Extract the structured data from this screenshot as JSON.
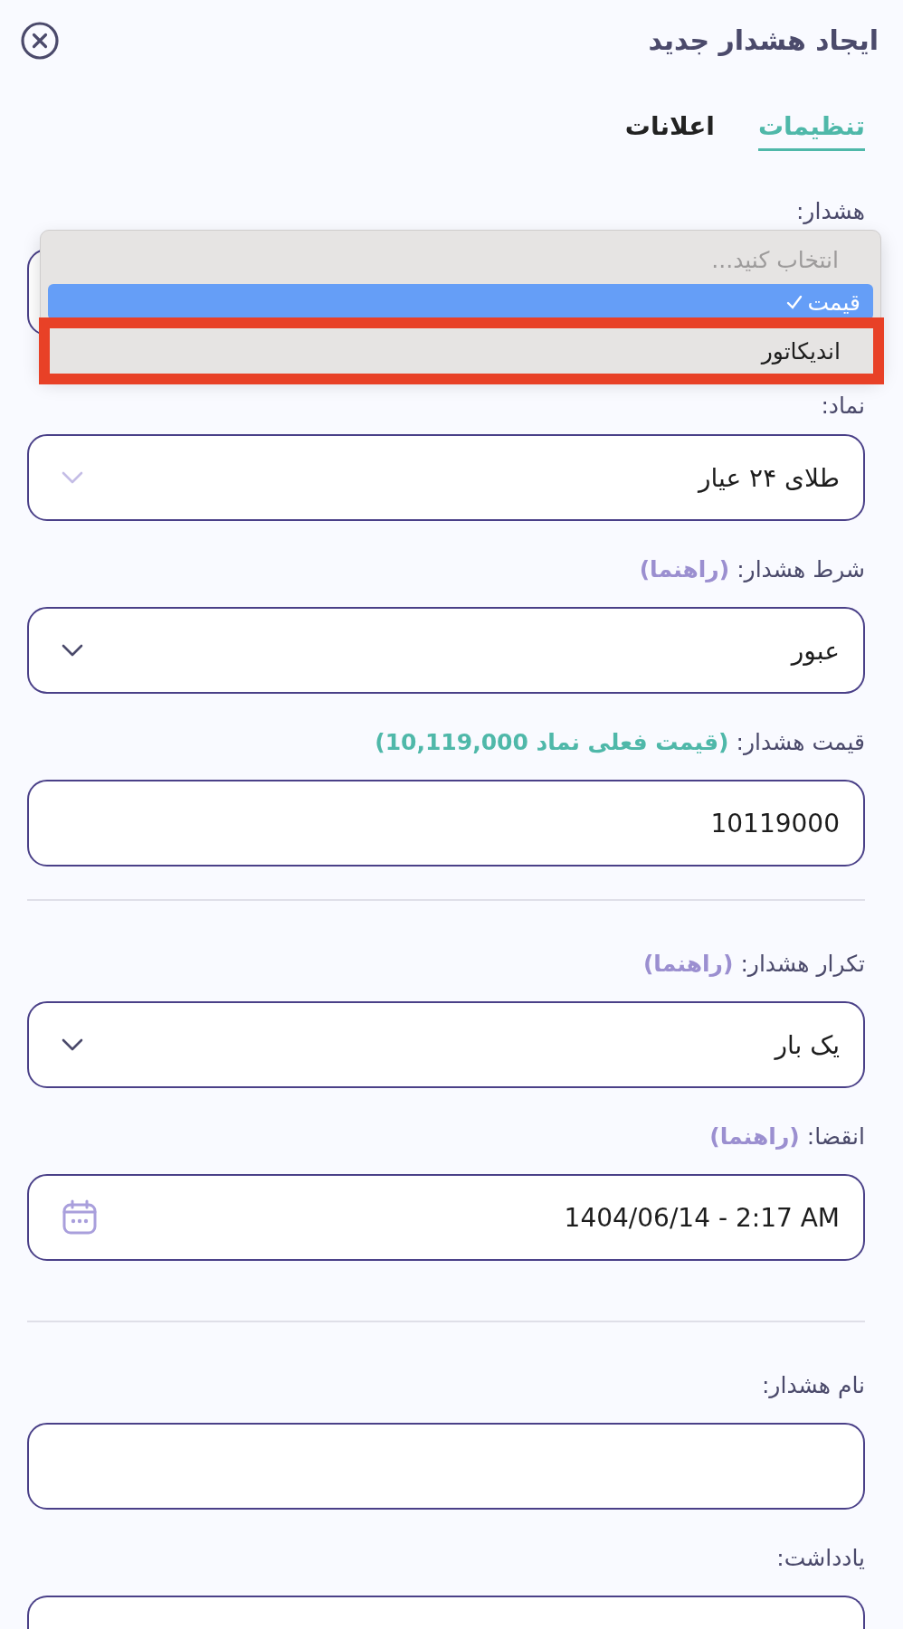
{
  "header": {
    "title": "ایجاد هشدار جدید"
  },
  "tabs": [
    {
      "label": "تنظیمات",
      "selected": true
    },
    {
      "label": "اعلانات",
      "selected": false
    }
  ],
  "sections": [
    {
      "fields": [
        {
          "label": "هشدار:",
          "kind": "select"
        },
        {
          "label": "نماد:",
          "kind": "select",
          "value": "طلای ۲۴ عیار",
          "disabled": true
        },
        {
          "label": "شرط هشدار:",
          "hint": {
            "text": "(راهنما)",
            "color": "#9b8fd0"
          },
          "kind": "select",
          "value": "عبور",
          "disabled": false
        },
        {
          "label": "قیمت هشدار:",
          "hint": {
            "text": "(قیمت فعلی نماد 10,119,000)",
            "color": "#4fb8a9"
          },
          "kind": "text",
          "value": "10119000"
        }
      ]
    },
    {
      "fields": [
        {
          "label": "تکرار هشدار:",
          "hint": {
            "text": "(راهنما)",
            "color": "#9b8fd0"
          },
          "kind": "select",
          "value": "یک بار",
          "disabled": false
        },
        {
          "label": "انقضا:",
          "hint": {
            "text": "(راهنما)",
            "color": "#9b8fd0"
          },
          "kind": "date",
          "value": "1404/06/14 - 2:17 AM"
        }
      ]
    },
    {
      "fields": [
        {
          "label": "نام هشدار:",
          "kind": "text"
        },
        {
          "label": "یادداشت:",
          "kind": "textarea"
        }
      ]
    }
  ],
  "dropdown": {
    "options": [
      {
        "label": "انتخاب کنید...",
        "disabled": true,
        "selected": false,
        "highlighted": false
      },
      {
        "label": "قیمت",
        "disabled": false,
        "selected": true,
        "highlighted": false
      },
      {
        "label": "اندیکاتور",
        "disabled": false,
        "selected": false,
        "highlighted": true
      }
    ]
  }
}
